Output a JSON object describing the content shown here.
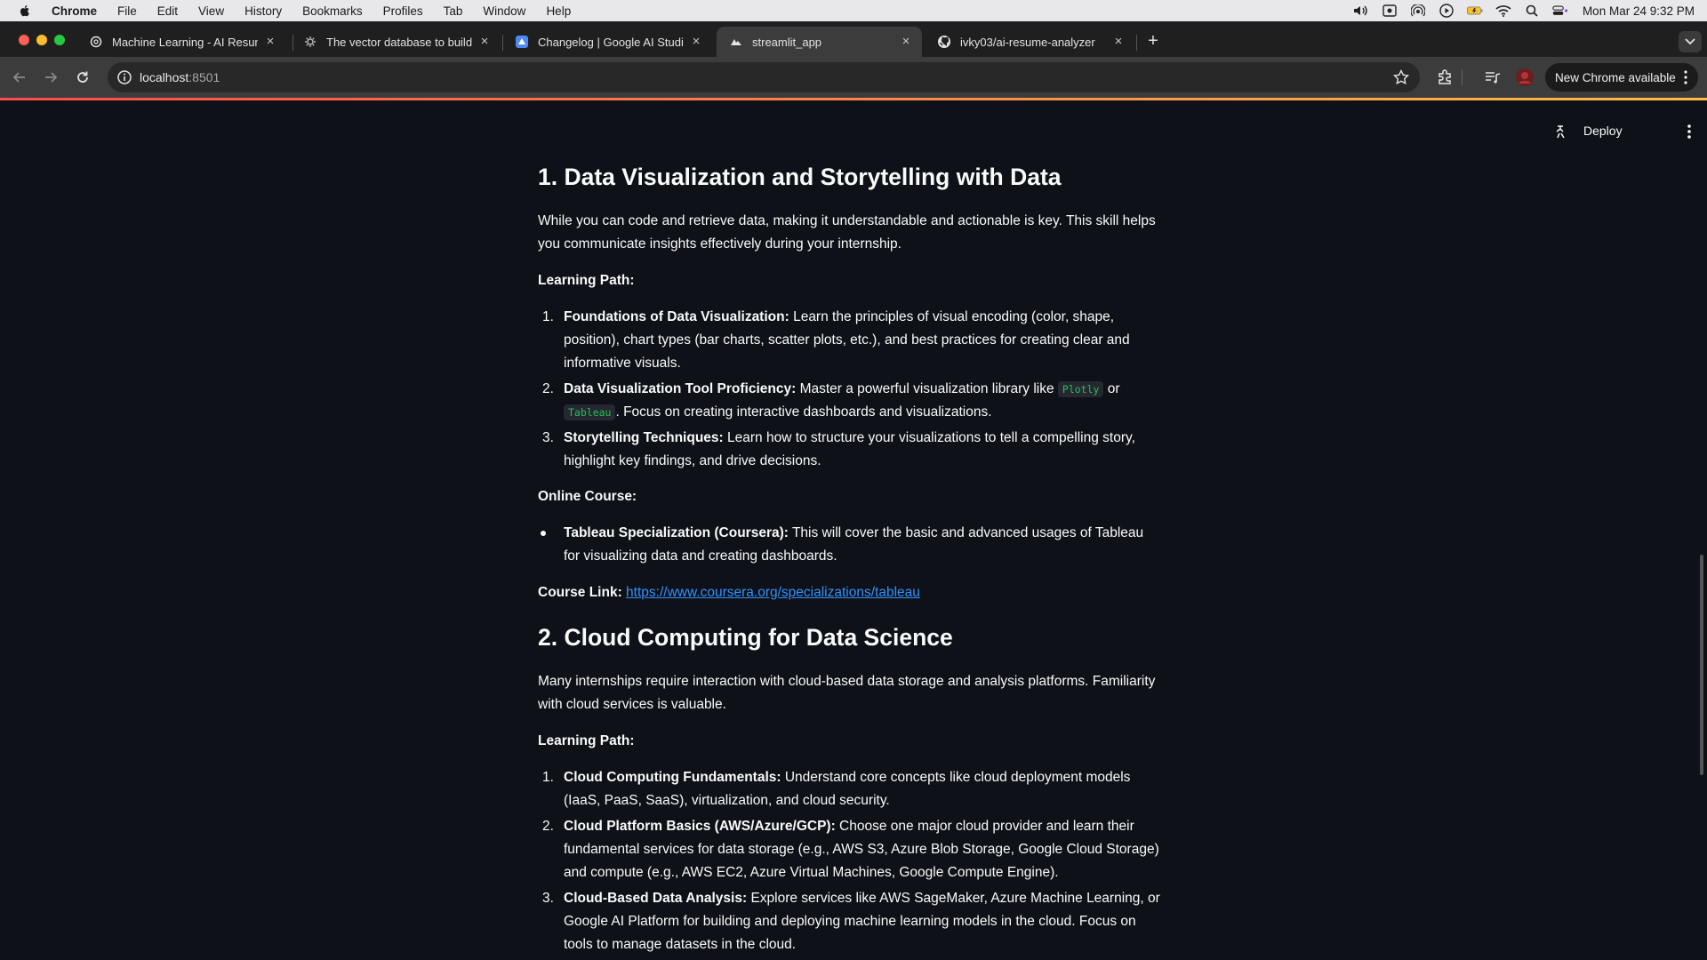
{
  "menubar": {
    "items": [
      "Chrome",
      "File",
      "Edit",
      "View",
      "History",
      "Bookmarks",
      "Profiles",
      "Tab",
      "Window",
      "Help"
    ],
    "clock": "Mon Mar 24  9:32 PM"
  },
  "tabs": [
    {
      "title": "Machine Learning - AI Resum",
      "favicon": "openai-icon"
    },
    {
      "title": "The vector database to build",
      "favicon": "gear-icon"
    },
    {
      "title": "Changelog | Google AI Studio",
      "favicon": "ai-studio-icon"
    },
    {
      "title": "streamlit_app",
      "favicon": "streamlit-icon",
      "active": true
    },
    {
      "title": "ivky03/ai-resume-analyzer",
      "favicon": "github-icon"
    }
  ],
  "toolbar": {
    "url_host": "localhost",
    "url_port": ":8501",
    "new_chrome_label": "New Chrome available"
  },
  "st_header": {
    "deploy_label": "Deploy"
  },
  "content": {
    "section1": {
      "heading": "1. Data Visualization and Storytelling with Data",
      "intro": "While you can code and retrieve data, making it understandable and actionable is key. This skill helps you communicate insights effectively during your internship.",
      "learning_path_label": "Learning Path:",
      "steps": [
        {
          "num": "1.",
          "title": "Foundations of Data Visualization:",
          "text": " Learn the principles of visual encoding (color, shape, position), chart types (bar charts, scatter plots, etc.), and best practices for creating clear and informative visuals."
        },
        {
          "num": "2.",
          "title": "Data Visualization Tool Proficiency:",
          "text_a": " Master a powerful visualization library like ",
          "code_a": "Plotly",
          "text_b": " or ",
          "code_b": "Tableau",
          "text_c": ". Focus on creating interactive dashboards and visualizations."
        },
        {
          "num": "3.",
          "title": "Storytelling Techniques:",
          "text": " Learn how to structure your visualizations to tell a compelling story, highlight key findings, and drive decisions."
        }
      ],
      "online_course_label": "Online Course:",
      "course": {
        "title": "Tableau Specialization (Coursera):",
        "text": " This will cover the basic and advanced usages of Tableau for visualizing data and creating dashboards."
      },
      "course_link_label": "Course Link:",
      "course_link": "https://www.coursera.org/specializations/tableau"
    },
    "section2": {
      "heading": "2. Cloud Computing for Data Science",
      "intro": "Many internships require interaction with cloud-based data storage and analysis platforms. Familiarity with cloud services is valuable.",
      "learning_path_label": "Learning Path:",
      "steps": [
        {
          "num": "1.",
          "title": "Cloud Computing Fundamentals:",
          "text": " Understand core concepts like cloud deployment models (IaaS, PaaS, SaaS), virtualization, and cloud security."
        },
        {
          "num": "2.",
          "title": "Cloud Platform Basics (AWS/Azure/GCP):",
          "text": " Choose one major cloud provider and learn their fundamental services for data storage (e.g., AWS S3, Azure Blob Storage, Google Cloud Storage) and compute (e.g., AWS EC2, Azure Virtual Machines, Google Compute Engine)."
        },
        {
          "num": "3.",
          "title": "Cloud-Based Data Analysis:",
          "text": " Explore services like AWS SageMaker, Azure Machine Learning, or Google AI Platform for building and deploying machine learning models in the cloud. Focus on tools to manage datasets in the cloud."
        }
      ]
    }
  },
  "colors": {
    "background": "#0e1117",
    "text": "#fafafa",
    "link": "#3391ff",
    "code": "#21c354"
  }
}
